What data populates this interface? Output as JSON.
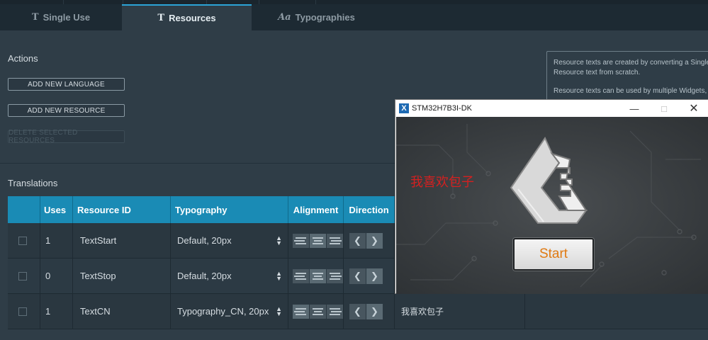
{
  "tabs": [
    {
      "icon": "T",
      "label": "Single Use",
      "active": false
    },
    {
      "icon": "T",
      "label": "Resources",
      "active": true
    },
    {
      "icon": "Aa",
      "label": "Typographies",
      "active": false
    }
  ],
  "actions": {
    "title": "Actions",
    "add_language": "ADD NEW LANGUAGE",
    "add_resource": "ADD NEW RESOURCE",
    "delete_selected": "DELETE SELECTED RESOURCES"
  },
  "info": {
    "line1": "Resource texts are created by converting a Single",
    "line2": "Resource text from scratch.",
    "line3": "Resource texts can be used by multiple Widgets,"
  },
  "translations": {
    "title": "Translations",
    "headers": {
      "uses": "Uses",
      "resource_id": "Resource ID",
      "typography": "Typography",
      "alignment": "Alignment",
      "direction": "Direction"
    },
    "rows": [
      {
        "uses": "1",
        "id": "TextStart",
        "typography": "Default, 20px",
        "alignment": "center",
        "translation": ""
      },
      {
        "uses": "0",
        "id": "TextStop",
        "typography": "Default, 20px",
        "alignment": "center",
        "translation": ""
      },
      {
        "uses": "1",
        "id": "TextCN",
        "typography": "Typography_CN, 20px",
        "alignment": "left",
        "translation": "我喜欢包子"
      }
    ]
  },
  "simulator": {
    "title": "STM32H7B3I-DK",
    "logo": "X",
    "cn_text": "我喜欢包子",
    "start_label": "Start",
    "icon": "touchgfx-logo-icon"
  },
  "colors": {
    "header": "#1a8bb5",
    "accent": "#2ba3d6",
    "cn_text": "#d42020",
    "start_text": "#e07a12"
  }
}
